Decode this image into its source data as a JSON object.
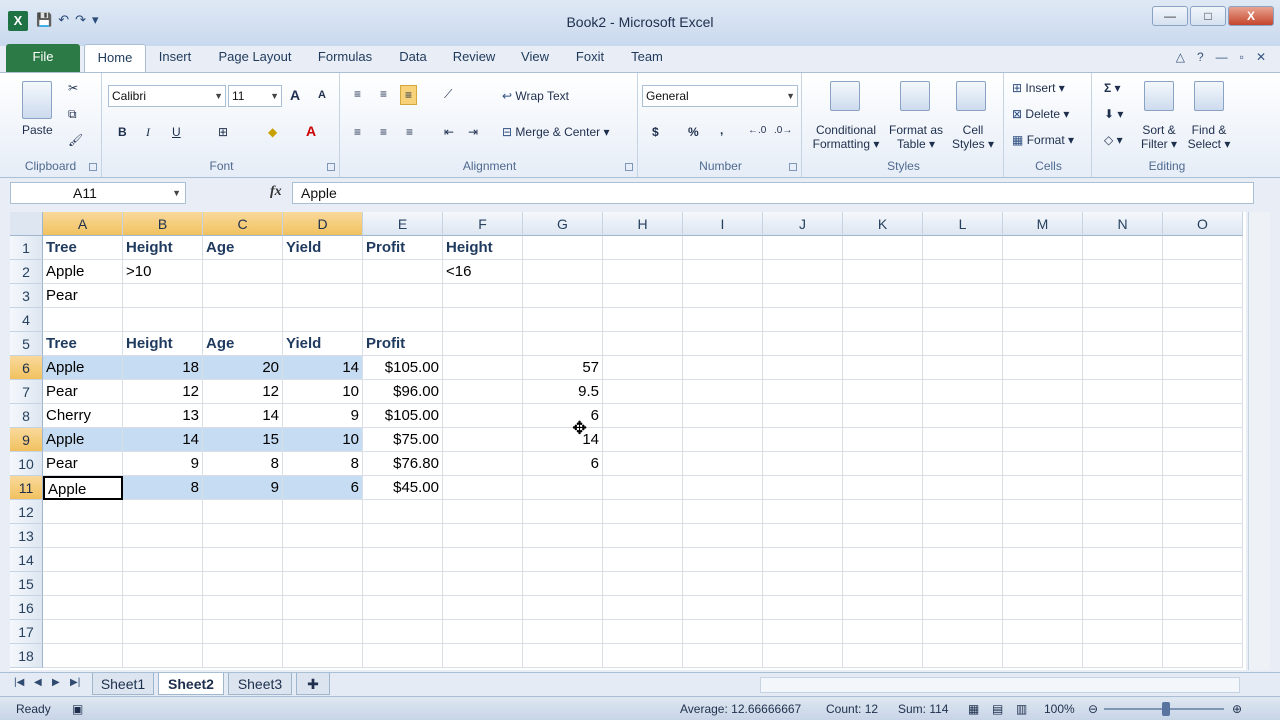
{
  "window": {
    "title": "Book2 - Microsoft Excel",
    "minimize": "—",
    "maximize": "□",
    "close": "X"
  },
  "tabs": [
    {
      "label": "File"
    },
    {
      "label": "Home"
    },
    {
      "label": "Insert"
    },
    {
      "label": "Page Layout"
    },
    {
      "label": "Formulas"
    },
    {
      "label": "Data"
    },
    {
      "label": "Review"
    },
    {
      "label": "View"
    },
    {
      "label": "Foxit"
    },
    {
      "label": "Team"
    }
  ],
  "ribbon": {
    "clipboard": {
      "label": "Clipboard",
      "paste": "Paste"
    },
    "font": {
      "label": "Font",
      "name": "Calibri",
      "size": "11",
      "grow": "A",
      "shrink": "A",
      "bold": "B",
      "italic": "I",
      "underline": "U"
    },
    "alignment": {
      "label": "Alignment",
      "wrap_text": "Wrap Text",
      "merge_center": "Merge & Center"
    },
    "number": {
      "label": "Number",
      "format": "General",
      "currency": "$",
      "percent": "%",
      "comma": ","
    },
    "styles": {
      "label": "Styles",
      "conditional_l1": "Conditional",
      "conditional_l2": "Formatting",
      "format_table_l1": "Format as",
      "format_table_l2": "Table",
      "cell_styles_l1": "Cell",
      "cell_styles_l2": "Styles"
    },
    "cells": {
      "label": "Cells",
      "insert": "Insert",
      "delete": "Delete",
      "format": "Format"
    },
    "editing": {
      "label": "Editing",
      "sort_l1": "Sort &",
      "sort_l2": "Filter",
      "find_l1": "Find &",
      "find_l2": "Select",
      "sum": "Σ"
    }
  },
  "formula_bar": {
    "name_box": "A11",
    "fx": "fx",
    "content": "Apple"
  },
  "columns": [
    "A",
    "B",
    "C",
    "D",
    "E",
    "F",
    "G",
    "H",
    "I",
    "J",
    "K",
    "L",
    "M",
    "N",
    "O"
  ],
  "rows": [
    "1",
    "2",
    "3",
    "4",
    "5",
    "6",
    "7",
    "8",
    "9",
    "10",
    "11",
    "12",
    "13",
    "14",
    "15",
    "16",
    "17",
    "18"
  ],
  "cells": {
    "A1": "Tree",
    "B1": "Height",
    "C1": "Age",
    "D1": "Yield",
    "E1": "Profit",
    "F1": "Height",
    "A2": "Apple",
    "B2": ">10",
    "F2": "<16",
    "A3": "Pear",
    "A5": "Tree",
    "B5": "Height",
    "C5": "Age",
    "D5": "Yield",
    "E5": "Profit",
    "A6": "Apple",
    "B6": "18",
    "C6": "20",
    "D6": "14",
    "E6": "$105.00",
    "G6": "57",
    "A7": "Pear",
    "B7": "12",
    "C7": "12",
    "D7": "10",
    "E7": "$96.00",
    "G7": "9.5",
    "A8": "Cherry",
    "B8": "13",
    "C8": "14",
    "D8": "9",
    "E8": "$105.00",
    "G8": "6",
    "A9": "Apple",
    "B9": "14",
    "C9": "15",
    "D9": "10",
    "E9": "$75.00",
    "G9": "14",
    "A10": "Pear",
    "B10": "9",
    "C10": "8",
    "D10": "8",
    "E10": "$76.80",
    "G10": "6",
    "A11": "Apple",
    "B11": "8",
    "C11": "9",
    "D11": "6",
    "E11": "$45.00"
  },
  "sheets": [
    "Sheet1",
    "Sheet2",
    "Sheet3"
  ],
  "active_sheet": "Sheet2",
  "status": {
    "ready": "Ready",
    "average": "Average: 12.66666667",
    "count": "Count: 12",
    "sum": "Sum: 114",
    "zoom": "100%"
  }
}
